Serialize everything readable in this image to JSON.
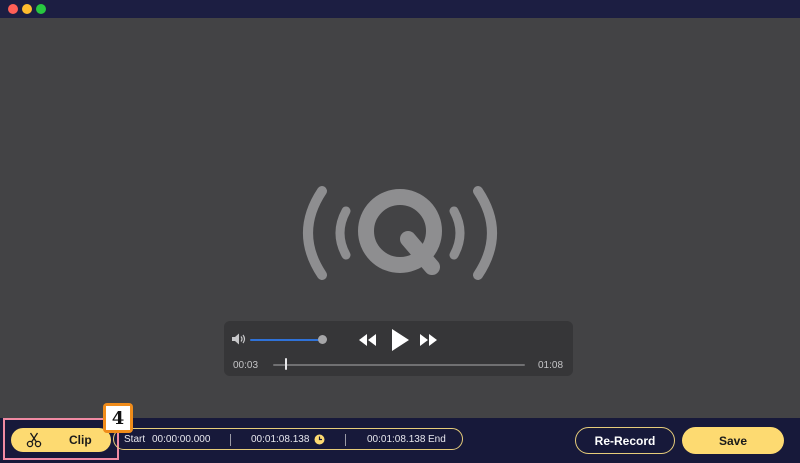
{
  "player": {
    "current_time": "00:03",
    "total_time": "01:08",
    "volume_level": 0.95,
    "progress": 0.05
  },
  "toolbar": {
    "clip_label": "Clip",
    "start_label": "Start",
    "start_time": "00:00:00.000",
    "mid_time": "00:01:08.138",
    "end_time": "00:01:08.138",
    "end_label": "End",
    "rerecord_label": "Re-Record",
    "save_label": "Save"
  },
  "annotation": {
    "step_number": "4"
  },
  "colors": {
    "accent_yellow": "#fdda71",
    "highlight_pink": "#f08aa2",
    "badge_orange": "#f08c1a",
    "volume_blue": "#2f72d8",
    "background_navy": "#17193a",
    "stage_gray": "#434345"
  },
  "icons": [
    "speaker-icon",
    "rewind-icon",
    "play-icon",
    "fast-forward-icon",
    "scissors-icon",
    "clock-icon",
    "app-logo-icon"
  ]
}
